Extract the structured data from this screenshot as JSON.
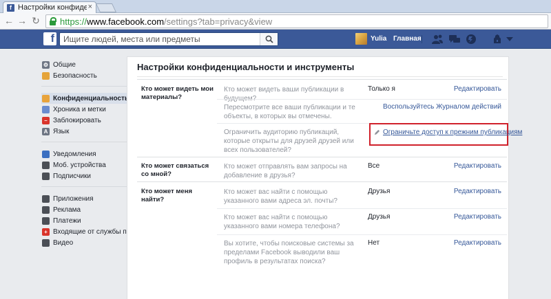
{
  "browser": {
    "tab_title": "Настройки конфиденци",
    "tab_close": "×",
    "favicon": "f",
    "url_scheme": "https://",
    "url_host": "www.facebook.com",
    "url_path": "/settings?tab=privacy&view"
  },
  "topbar": {
    "logo": "f",
    "search_placeholder": "Ищите людей, места или предметы",
    "user_name": "Yulia",
    "home_label": "Главная",
    "icons": [
      "friends-icon",
      "messages-icon",
      "notifications-icon",
      "privacy-shortcuts-icon",
      "settings-dropdown-icon"
    ]
  },
  "page": {
    "title": "Настройки конфиденциальности и инструменты"
  },
  "sidebar": {
    "groups": [
      [
        {
          "label": "Общие",
          "icon": "gear-icon"
        },
        {
          "label": "Безопасность",
          "icon": "shield-icon"
        }
      ],
      [
        {
          "label": "Конфиденциальность",
          "icon": "lock-icon",
          "active": true
        },
        {
          "label": "Хроника и метки",
          "icon": "timeline-icon"
        },
        {
          "label": "Заблокировать",
          "icon": "block-icon"
        },
        {
          "label": "Язык",
          "icon": "language-icon"
        }
      ],
      [
        {
          "label": "Уведомления",
          "icon": "globe-icon"
        },
        {
          "label": "Моб. устройства",
          "icon": "mobile-icon"
        },
        {
          "label": "Подписчики",
          "icon": "rss-icon"
        }
      ],
      [
        {
          "label": "Приложения",
          "icon": "apps-icon"
        },
        {
          "label": "Реклама",
          "icon": "ads-icon"
        },
        {
          "label": "Платежи",
          "icon": "payments-icon"
        },
        {
          "label": "Входящие от службы по...",
          "icon": "support-icon"
        },
        {
          "label": "Видео",
          "icon": "video-icon"
        }
      ]
    ]
  },
  "sections": {
    "who_can_see": {
      "category": "Кто может видеть мои материалы?",
      "q1": "Кто может видеть ваши публикации в будущем?",
      "v1": "Только я",
      "e1": "Редактировать",
      "q2": "Пересмотрите все ваши публикации и те объекты, в которых вы отмечены.",
      "e2": "Воспользуйтесь Журналом действий",
      "q3": "Ограничить аудиторию публикаций, которые открыты для друзей друзей или всех пользователей?",
      "e3": "Ограничьте доступ к прежним публикациям"
    },
    "who_can_contact": {
      "category": "Кто может связаться со мной?",
      "q1": "Кто может отправлять вам запросы на добавление в друзья?",
      "v1": "Все",
      "e1": "Редактировать"
    },
    "who_can_find": {
      "category": "Кто может меня найти?",
      "q1": "Кто может вас найти с помощью указанного вами адреса эл. почты?",
      "v1": "Друзья",
      "e1": "Редактировать",
      "q2": "Кто может вас найти с помощью указанного вами номера телефона?",
      "v2": "Друзья",
      "e2": "Редактировать",
      "q3": "Вы хотите, чтобы поисковые системы за пределами Facebook выводили ваш профиль в результатах поиска?",
      "v3": "Нет",
      "e3": "Редактировать"
    }
  },
  "colors": {
    "brand": "#3b5998",
    "link": "#365899",
    "highlight": "#d0202a",
    "url_secure": "#2b9a3b"
  }
}
